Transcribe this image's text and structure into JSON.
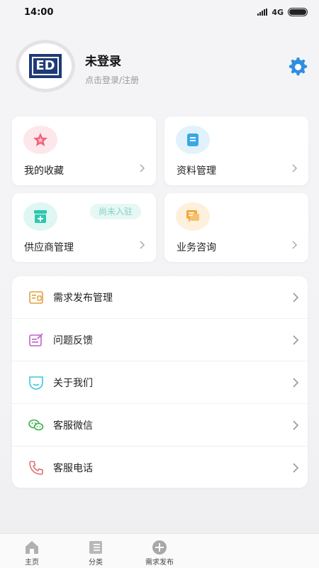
{
  "status_bar": {
    "time": "14:00",
    "network": "4G"
  },
  "profile": {
    "name": "未登录",
    "subtitle": "点击登录/注册",
    "logo_text": "ED"
  },
  "grid": [
    {
      "label": "我的收藏",
      "icon": "star-icon",
      "color": "#f2637b",
      "bg": "#fde7eb"
    },
    {
      "label": "资料管理",
      "icon": "document-icon",
      "color": "#38a8e6",
      "bg": "#e2f2fc"
    },
    {
      "label": "供应商管理",
      "icon": "store-icon",
      "color": "#2ec7b0",
      "bg": "#dff6f2",
      "badge": "尚未入驻"
    },
    {
      "label": "业务咨询",
      "icon": "chat-icon",
      "color": "#f4a93a",
      "bg": "#fdf0dc"
    }
  ],
  "menu": [
    {
      "label": "需求发布管理",
      "icon": "clipboard-icon"
    },
    {
      "label": "问题反馈",
      "icon": "feedback-icon"
    },
    {
      "label": "关于我们",
      "icon": "about-icon"
    },
    {
      "label": "客服微信",
      "icon": "wechat-icon"
    },
    {
      "label": "客服电话",
      "icon": "phone-icon"
    }
  ],
  "tabbar": [
    {
      "label": "主页",
      "icon": "home-icon"
    },
    {
      "label": "分类",
      "icon": "category-icon"
    },
    {
      "label": "需求发布",
      "icon": "add-icon"
    }
  ],
  "colors": {
    "accent": "#2f8fe0",
    "page_bg": "#f3f3f5",
    "logo_bg": "#1e3a78"
  }
}
